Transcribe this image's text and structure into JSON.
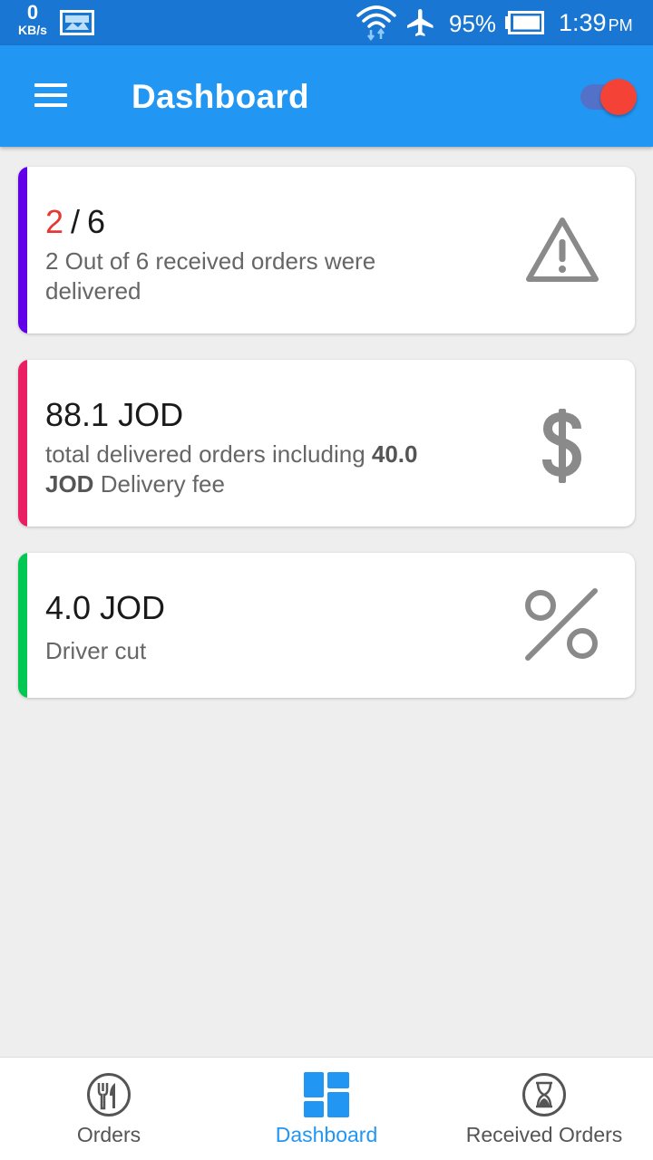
{
  "status_bar": {
    "net_speed": "0",
    "net_unit": "KB/s",
    "battery_percent": "95%",
    "time": "1:39",
    "ampm": "PM",
    "icons": [
      "image-notification-icon",
      "wifi-icon",
      "airplane-mode-icon",
      "battery-icon"
    ]
  },
  "app_bar": {
    "title": "Dashboard",
    "toggle_on": true,
    "colors": {
      "background": "#2196f3",
      "toggle_thumb": "#f44336"
    }
  },
  "cards": [
    {
      "value_delivered": "2",
      "value_separator": "/",
      "value_total": "6",
      "description": "2 Out of 6 received orders were delivered",
      "icon": "warning-icon",
      "accent": "#6200ea"
    },
    {
      "value": "88.1 JOD",
      "desc_prefix": "total delivered orders including",
      "desc_bold": "40.0 JOD",
      "desc_suffix": "Delivery fee",
      "icon": "dollar-icon",
      "accent": "#e91e63"
    },
    {
      "value": "4.0 JOD",
      "description": "Driver cut",
      "icon": "percent-icon",
      "accent": "#00c853"
    }
  ],
  "bottom_nav": {
    "items": [
      {
        "label": "Orders",
        "icon": "restaurant-icon",
        "active": false
      },
      {
        "label": "Dashboard",
        "icon": "dashboard-icon",
        "active": true
      },
      {
        "label": "Received Orders",
        "icon": "hourglass-icon",
        "active": false
      }
    ]
  }
}
